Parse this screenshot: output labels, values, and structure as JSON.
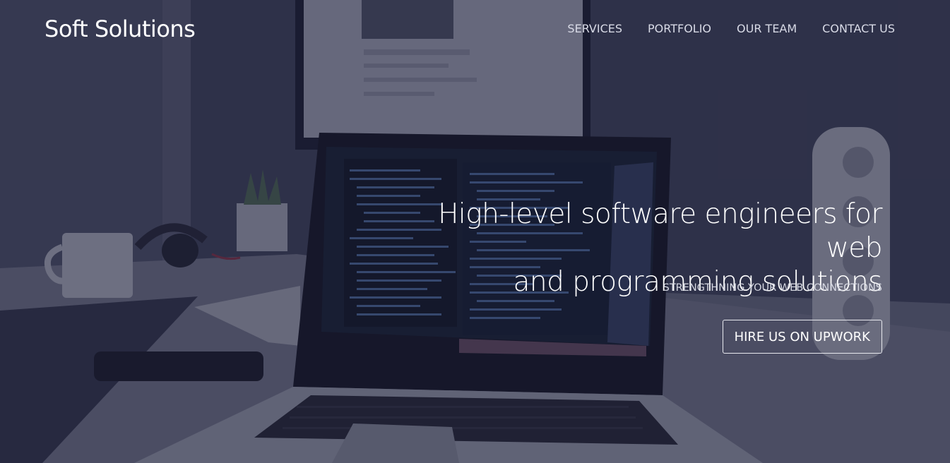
{
  "brand": {
    "name": "Soft Solutions"
  },
  "nav": {
    "items": [
      {
        "label": "SERVICES"
      },
      {
        "label": "PORTFOLIO"
      },
      {
        "label": "OUR TEAM"
      },
      {
        "label": "CONTACT US"
      }
    ]
  },
  "hero": {
    "headline_line1": "High-level software engineers for web",
    "headline_line2": "and programming solutions",
    "subheadline": "STRENGTHNING YOUR WEB CONNECTIONS",
    "cta_label": "HIRE US ON UPWORK",
    "background_image": "laptop-desk-photo"
  },
  "colors": {
    "overlay": "#1d2040",
    "text": "#ffffff",
    "nav_text": "#d8dae6"
  }
}
